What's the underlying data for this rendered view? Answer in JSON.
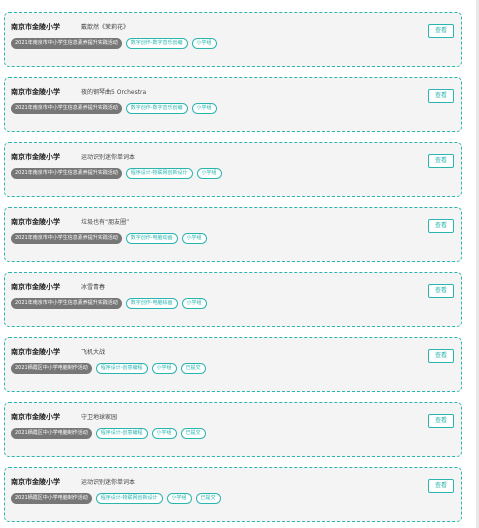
{
  "colors": {
    "accent": "#2bb5b0",
    "badge": "#777777",
    "card_bg": "#f4f4f4"
  },
  "view_label": "查看",
  "items": [
    {
      "school": "南京市金陵小学",
      "title": "戴歆然《茉莉花》",
      "activity": "2021年南京市中小学生信息素养提升实践活动",
      "tags": [
        "数字创作-数字音乐创编",
        "小学组"
      ]
    },
    {
      "school": "南京市金陵小学",
      "title": "夜的钢琴曲5 Orchestra",
      "activity": "2021年南京市中小学生信息素养提升实践活动",
      "tags": [
        "数字创作-数字音乐创编",
        "小学组"
      ]
    },
    {
      "school": "南京市金陵小学",
      "title": "运动识别迷你单词本",
      "activity": "2021年南京市中小学生信息素养提升实践活动",
      "tags": [
        "程序设计-物联网创新设计",
        "小学组"
      ]
    },
    {
      "school": "南京市金陵小学",
      "title": "垃圾也有“朋友圈”",
      "activity": "2021年南京市中小学生信息素养提升实践活动",
      "tags": [
        "数字创作-电脑动画",
        "小学组"
      ]
    },
    {
      "school": "南京市金陵小学",
      "title": "冰雪青春",
      "activity": "2021年南京市中小学生信息素养提升实践活动",
      "tags": [
        "数字创作-电脑绘画",
        "小学组"
      ]
    },
    {
      "school": "南京市金陵小学",
      "title": "飞机大战",
      "activity": "2021栖霞区中小学电脑制作活动",
      "tags": [
        "程序设计-创意编程",
        "小学组",
        "已提交"
      ]
    },
    {
      "school": "南京市金陵小学",
      "title": "守卫地球家园",
      "activity": "2021栖霞区中小学电脑制作活动",
      "tags": [
        "程序设计-创意编程",
        "小学组",
        "已提交"
      ]
    },
    {
      "school": "南京市金陵小学",
      "title": "运动识别迷你单词本",
      "activity": "2021栖霞区中小学电脑制作活动",
      "tags": [
        "程序设计-物联网创新设计",
        "小学组",
        "已提交"
      ]
    }
  ]
}
